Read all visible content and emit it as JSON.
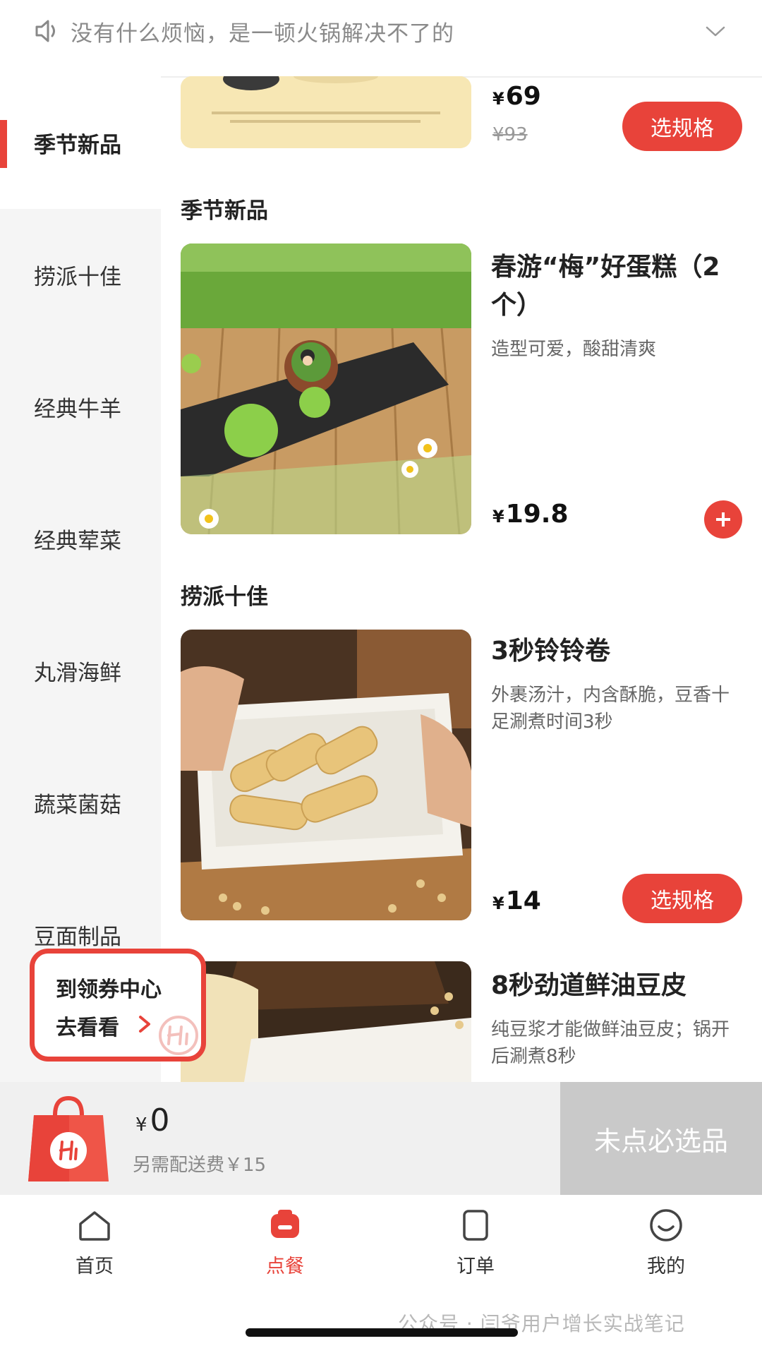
{
  "notice": {
    "text": "没有什么烦恼，是一顿火锅解决不了的",
    "icons": [
      "speaker-icon",
      "chevron-down-icon"
    ]
  },
  "sidebar": {
    "items": [
      {
        "label": "季节新品",
        "active": true
      },
      {
        "label": "捞派十佳",
        "active": false
      },
      {
        "label": "经典牛羊",
        "active": false
      },
      {
        "label": "经典荤菜",
        "active": false
      },
      {
        "label": "丸滑海鲜",
        "active": false
      },
      {
        "label": "蔬菜菌菇",
        "active": false
      },
      {
        "label": "豆面制品",
        "active": false
      }
    ]
  },
  "menu": {
    "partial_item": {
      "currency": "¥",
      "price": "69",
      "original_price": "¥93",
      "button": "选规格"
    },
    "sections": [
      {
        "title": "季节新品",
        "items": [
          {
            "name": "春游“梅”好蛋糕（2个）",
            "desc": "造型可爱，酸甜清爽",
            "currency": "¥",
            "price": "19.8",
            "action": "add"
          }
        ]
      },
      {
        "title": "捞派十佳",
        "items": [
          {
            "name": "3秒铃铃卷",
            "desc": "外裹汤汁，内含酥脆，豆香十足涮煮时间3秒",
            "currency": "¥",
            "price": "14",
            "button": "选规格"
          },
          {
            "name": "8秒劲道鲜油豆皮",
            "desc": "纯豆浆才能做鲜油豆皮；锅开后涮煮8秒"
          }
        ]
      }
    ]
  },
  "coupon": {
    "line1": "到领券中心",
    "line2": "去看看"
  },
  "cart": {
    "currency": "¥",
    "total": "0",
    "delivery_note": "另需配送费￥15",
    "checkout_label": "未点必选品"
  },
  "tabs": [
    {
      "label": "首页",
      "icon": "home-icon",
      "active": false
    },
    {
      "label": "点餐",
      "icon": "order-food-icon",
      "active": true
    },
    {
      "label": "订单",
      "icon": "orders-icon",
      "active": false
    },
    {
      "label": "我的",
      "icon": "profile-icon",
      "active": false
    }
  ],
  "watermark": "公众号 · 闫爷用户增长实战笔记",
  "colors": {
    "accent": "#e8433a",
    "sidebar_bg": "#f5f5f5",
    "cartbar_bg": "#f0f0f0",
    "checkout_disabled": "#c9c9c9"
  }
}
